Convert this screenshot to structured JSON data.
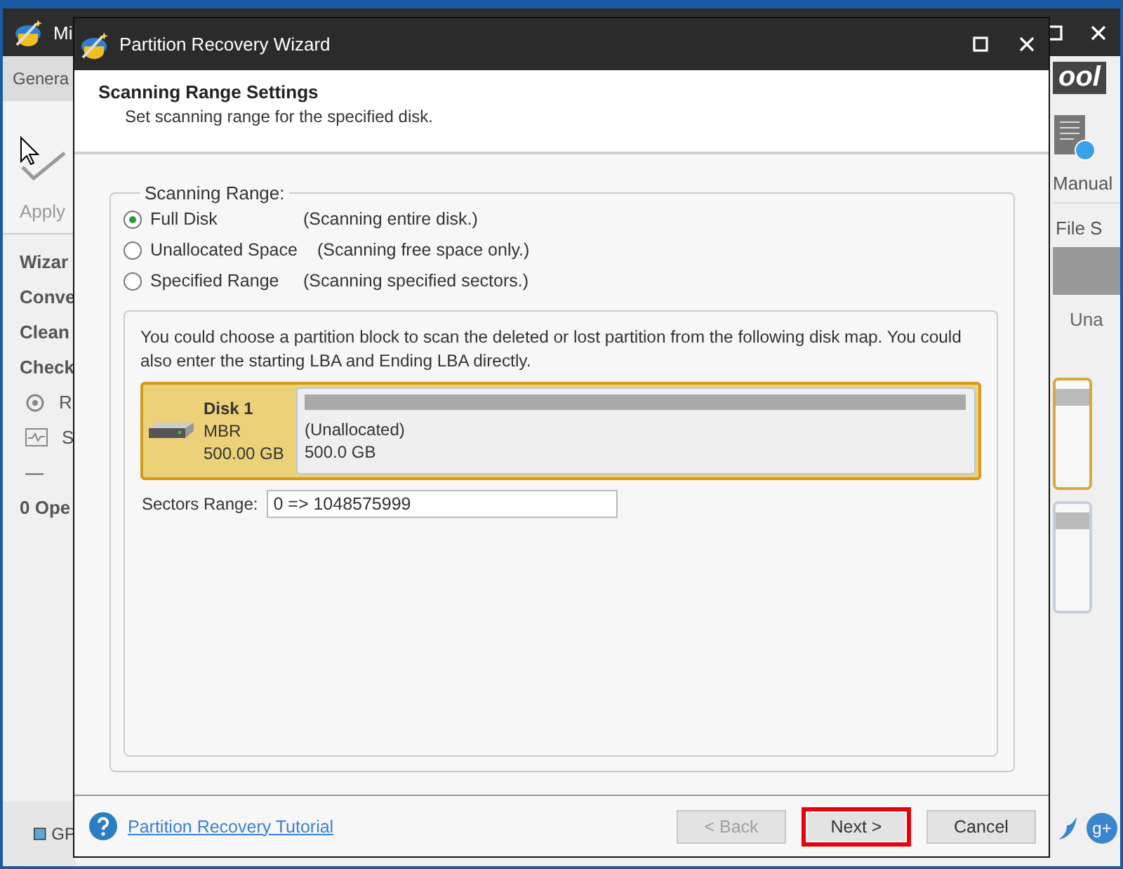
{
  "app": {
    "title": "Mi",
    "menu_tab": "Genera",
    "toolbar": [
      {
        "label": "Apply",
        "disabled": true
      }
    ],
    "sidebar_headings": [
      "Wizar",
      "Conve",
      "Clean",
      "Check"
    ],
    "sidebar_items": [
      {
        "label": "R",
        "kind": "recover"
      },
      {
        "label": "S",
        "kind": "chart"
      }
    ],
    "sidebar_dash": "—",
    "operations": "0 Ope",
    "legend": "GP",
    "logo": "ool",
    "manual_label": "Manual",
    "column_header": "File S",
    "cell": "Una",
    "share_label": "g+"
  },
  "dialog": {
    "title": "Partition Recovery Wizard",
    "heading": "Scanning Range Settings",
    "subheading": "Set scanning range for the specified disk.",
    "group_label": "Scanning Range:",
    "options": [
      {
        "label": "Full Disk",
        "hint": "(Scanning entire disk.)",
        "selected": true
      },
      {
        "label": "Unallocated Space",
        "hint": "(Scanning free space only.)",
        "selected": false
      },
      {
        "label": "Specified Range",
        "hint": "(Scanning specified sectors.)",
        "selected": false
      }
    ],
    "instructions": "You could choose a partition block to scan the deleted or lost partition from the following disk map. You could also enter the starting LBA and Ending LBA directly.",
    "disk": {
      "name": "Disk 1",
      "type": "MBR",
      "size": "500.00 GB",
      "selected": true,
      "partitions": [
        {
          "label": "(Unallocated)",
          "size": "500.0 GB"
        }
      ]
    },
    "sectors_label": "Sectors Range:",
    "sectors_value": "0 => 1048575999",
    "help_link": "Partition Recovery Tutorial",
    "buttons": [
      {
        "label": "< Back",
        "disabled": true,
        "highlighted": false
      },
      {
        "label": "Next >",
        "disabled": false,
        "highlighted": true
      },
      {
        "label": "Cancel",
        "disabled": false,
        "highlighted": false
      }
    ]
  }
}
